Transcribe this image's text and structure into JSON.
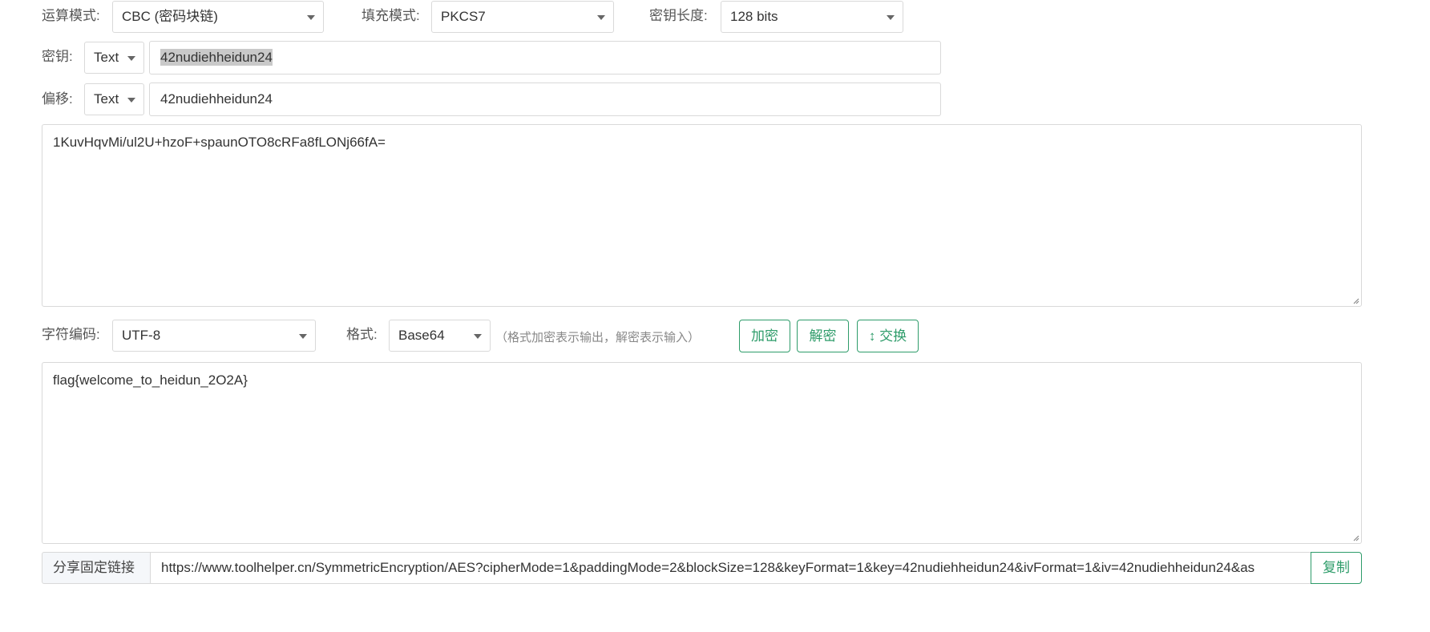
{
  "settings": {
    "mode_label": "运算模式:",
    "mode_value": "CBC (密码块链)",
    "padding_label": "填充模式:",
    "padding_value": "PKCS7",
    "keylen_label": "密钥长度:",
    "keylen_value": "128 bits"
  },
  "key": {
    "label": "密钥:",
    "format": "Text",
    "value": "42nudiehheidun24"
  },
  "iv": {
    "label": "偏移:",
    "format": "Text",
    "value": "42nudiehheidun24"
  },
  "input_text": "1KuvHqvMi/ul2U+hzoF+spaunOTO8cRFa8fLONj66fA=",
  "encoding": {
    "charset_label": "字符编码:",
    "charset_value": "UTF-8",
    "format_label": "格式:",
    "format_value": "Base64",
    "hint": "（格式加密表示输出，解密表示输入）"
  },
  "actions": {
    "encrypt": "加密",
    "decrypt": "解密",
    "swap": "↕ 交换"
  },
  "output_text": "flag{welcome_to_heidun_2O2A}",
  "share": {
    "label": "分享固定链接",
    "url": "https://www.toolhelper.cn/SymmetricEncryption/AES?cipherMode=1&paddingMode=2&blockSize=128&keyFormat=1&key=42nudiehheidun24&ivFormat=1&iv=42nudiehheidun24&as",
    "copy": "复制"
  },
  "colors": {
    "accent": "#2e9c6a",
    "border": "#d9d9d9"
  }
}
